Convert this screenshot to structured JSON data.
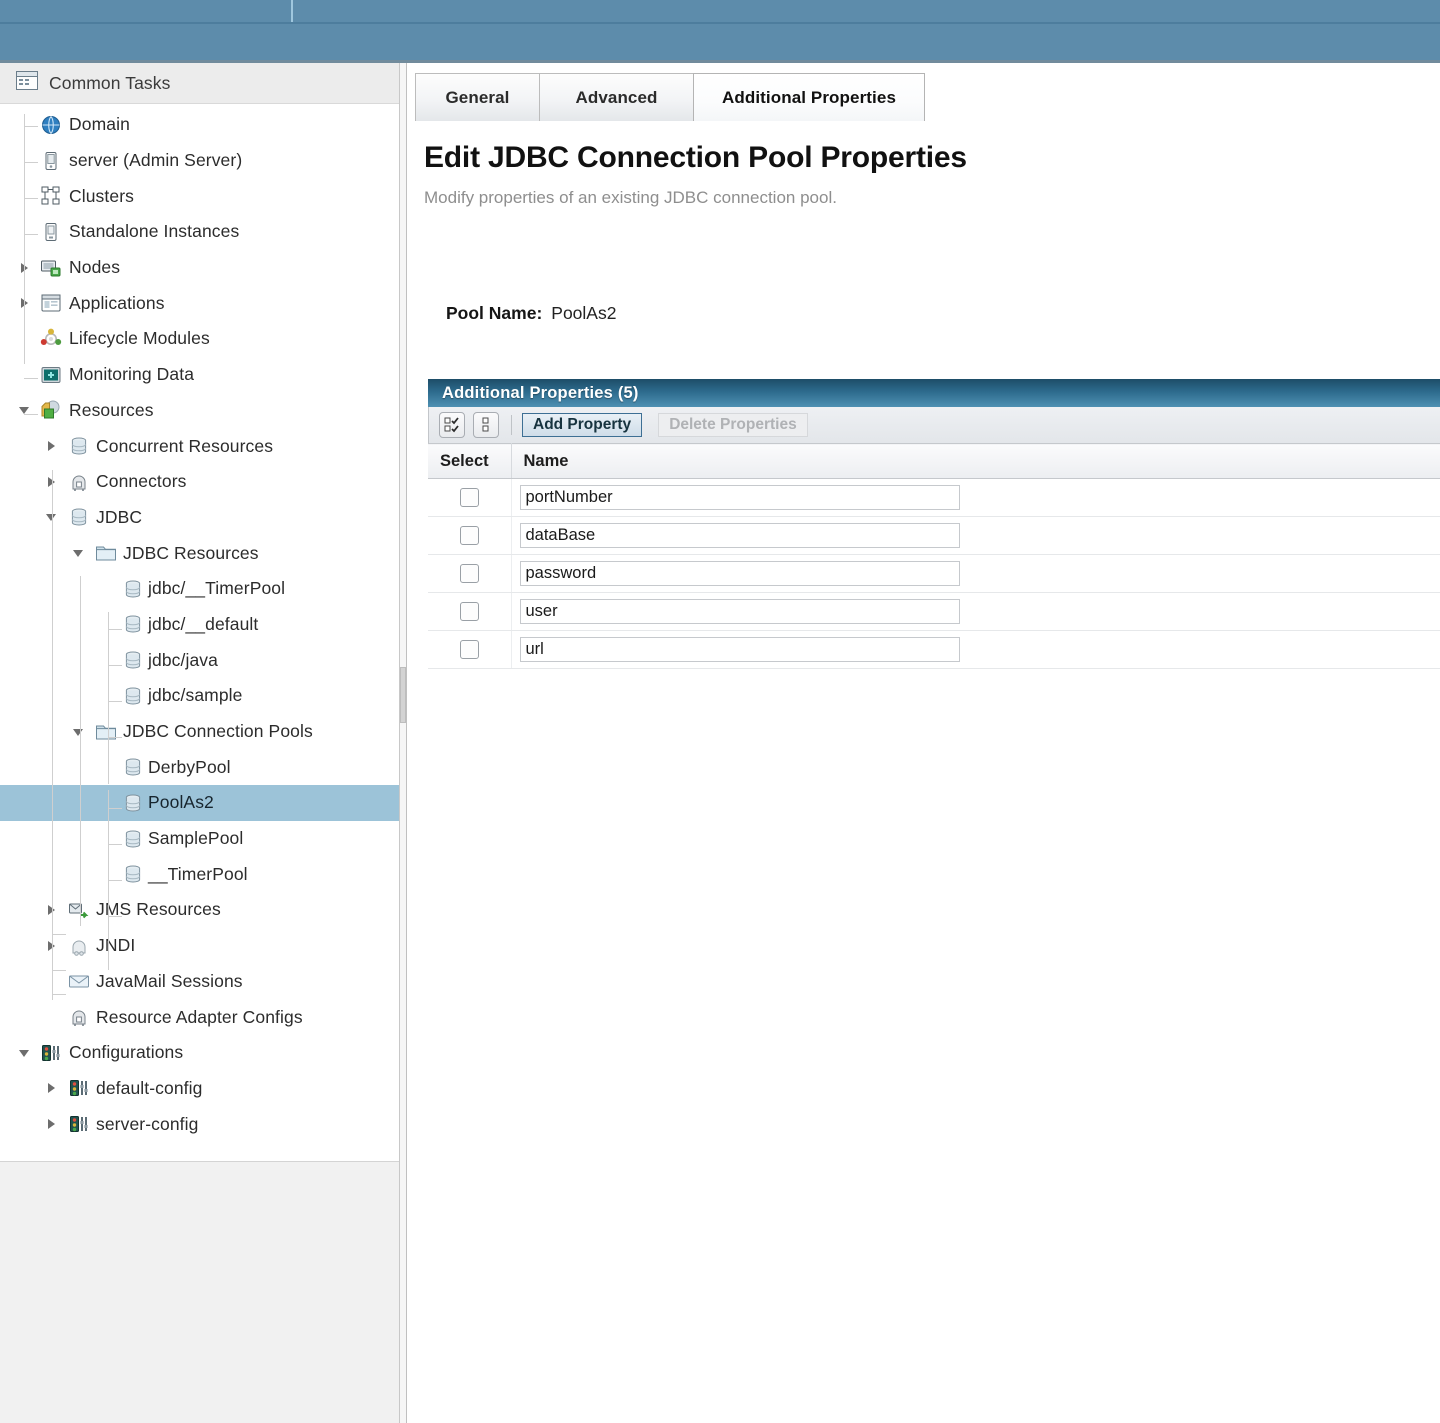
{
  "topbar": {
    "title": ""
  },
  "sidebar": {
    "header": {
      "label": "Common Tasks",
      "icon": "window-icon"
    },
    "items": [
      {
        "label": "Domain",
        "icon": "globe-icon",
        "depth": 0,
        "twisty": "none",
        "selected": false
      },
      {
        "label": "server (Admin Server)",
        "icon": "server-icon",
        "depth": 0,
        "twisty": "none",
        "selected": false
      },
      {
        "label": "Clusters",
        "icon": "cluster-icon",
        "depth": 0,
        "twisty": "none",
        "selected": false
      },
      {
        "label": "Standalone Instances",
        "icon": "instance-icon",
        "depth": 0,
        "twisty": "none",
        "selected": false
      },
      {
        "label": "Nodes",
        "icon": "node-icon",
        "depth": 0,
        "twisty": "closed",
        "selected": false
      },
      {
        "label": "Applications",
        "icon": "app-icon",
        "depth": 0,
        "twisty": "closed",
        "selected": false
      },
      {
        "label": "Lifecycle Modules",
        "icon": "lifecycle-icon",
        "depth": 0,
        "twisty": "none",
        "selected": false
      },
      {
        "label": "Monitoring Data",
        "icon": "monitor-icon",
        "depth": 0,
        "twisty": "none",
        "selected": false
      },
      {
        "label": "Resources",
        "icon": "resources-icon",
        "depth": 0,
        "twisty": "open",
        "selected": false
      },
      {
        "label": "Concurrent Resources",
        "icon": "database-icon",
        "depth": 1,
        "twisty": "closed",
        "selected": false
      },
      {
        "label": "Connectors",
        "icon": "connector-icon",
        "depth": 1,
        "twisty": "closed",
        "selected": false
      },
      {
        "label": "JDBC",
        "icon": "database-icon",
        "depth": 1,
        "twisty": "open",
        "selected": false
      },
      {
        "label": "JDBC Resources",
        "icon": "folder-icon",
        "depth": 2,
        "twisty": "open",
        "selected": false
      },
      {
        "label": "jdbc/__TimerPool",
        "icon": "database-icon",
        "depth": 3,
        "twisty": "none",
        "selected": false
      },
      {
        "label": "jdbc/__default",
        "icon": "database-icon",
        "depth": 3,
        "twisty": "none",
        "selected": false
      },
      {
        "label": "jdbc/java",
        "icon": "database-icon",
        "depth": 3,
        "twisty": "none",
        "selected": false
      },
      {
        "label": "jdbc/sample",
        "icon": "database-icon",
        "depth": 3,
        "twisty": "none",
        "selected": false
      },
      {
        "label": "JDBC Connection Pools",
        "icon": "folder-icon",
        "depth": 2,
        "twisty": "open",
        "selected": false
      },
      {
        "label": "DerbyPool",
        "icon": "database-icon",
        "depth": 3,
        "twisty": "none",
        "selected": false
      },
      {
        "label": "PoolAs2",
        "icon": "database-icon",
        "depth": 3,
        "twisty": "none",
        "selected": true
      },
      {
        "label": "SamplePool",
        "icon": "database-icon",
        "depth": 3,
        "twisty": "none",
        "selected": false
      },
      {
        "label": "__TimerPool",
        "icon": "database-icon",
        "depth": 3,
        "twisty": "none",
        "selected": false
      },
      {
        "label": "JMS Resources",
        "icon": "jms-icon",
        "depth": 1,
        "twisty": "closed",
        "selected": false
      },
      {
        "label": "JNDI",
        "icon": "jndi-icon",
        "depth": 1,
        "twisty": "closed",
        "selected": false
      },
      {
        "label": "JavaMail Sessions",
        "icon": "mail-icon",
        "depth": 1,
        "twisty": "none",
        "selected": false
      },
      {
        "label": "Resource Adapter Configs",
        "icon": "connector-icon",
        "depth": 1,
        "twisty": "none",
        "selected": false
      },
      {
        "label": "Configurations",
        "icon": "config-icon",
        "depth": 0,
        "twisty": "open",
        "selected": false
      },
      {
        "label": "default-config",
        "icon": "config-icon",
        "depth": 1,
        "twisty": "closed",
        "selected": false
      },
      {
        "label": "server-config",
        "icon": "config-icon",
        "depth": 1,
        "twisty": "closed",
        "selected": false
      }
    ]
  },
  "main": {
    "tabs": [
      {
        "label": "General",
        "active": false
      },
      {
        "label": "Advanced",
        "active": false
      },
      {
        "label": "Additional Properties",
        "active": true
      }
    ],
    "page_title": "Edit JDBC Connection Pool Properties",
    "page_subtitle": "Modify properties of an existing JDBC connection pool.",
    "pool_name_label": "Pool Name:",
    "pool_name_value": "PoolAs2",
    "panel": {
      "title": "Additional Properties (5)",
      "toolbar": {
        "select_all_icon": "select-all-icon",
        "deselect_all_icon": "deselect-all-icon",
        "add_label": "Add Property",
        "delete_label": "Delete Properties"
      },
      "columns": [
        "Select",
        "Name"
      ],
      "rows": [
        {
          "selected": false,
          "name": "portNumber"
        },
        {
          "selected": false,
          "name": "dataBase"
        },
        {
          "selected": false,
          "name": "password"
        },
        {
          "selected": false,
          "name": "user"
        },
        {
          "selected": false,
          "name": "url"
        }
      ]
    }
  },
  "colors": {
    "banner": "#5d8cab",
    "panel_header": "#2d6b8d",
    "tree_selection": "#9cc3d8",
    "accent_border": "#3d6f94"
  }
}
